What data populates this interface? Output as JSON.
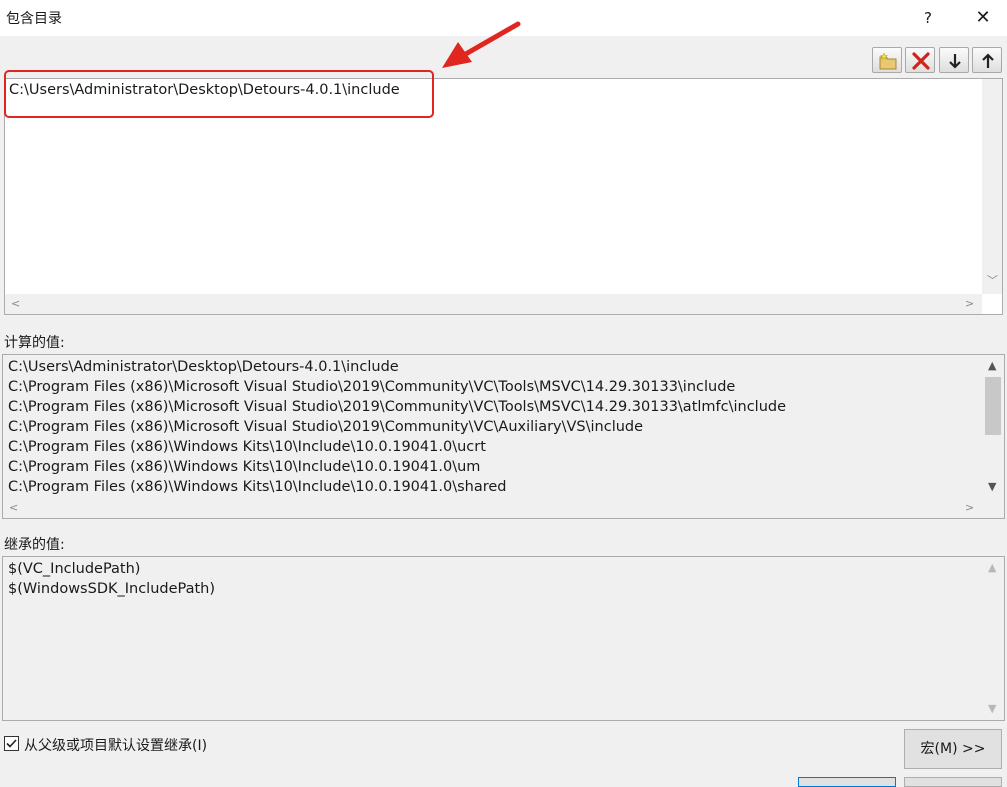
{
  "window": {
    "title": "包含目录",
    "help_label": "?",
    "close_label": "✕"
  },
  "toolbar": {
    "new_line_icon": "new-folder-icon",
    "delete_icon": "delete-x-icon",
    "move_down_icon": "arrow-down-icon",
    "move_up_icon": "arrow-up-icon"
  },
  "editor": {
    "lines": [
      "C:\\Users\\Administrator\\Desktop\\Detours-4.0.1\\include"
    ]
  },
  "computed": {
    "label": "计算的值:",
    "lines": [
      "C:\\Users\\Administrator\\Desktop\\Detours-4.0.1\\include",
      "C:\\Program Files (x86)\\Microsoft Visual Studio\\2019\\Community\\VC\\Tools\\MSVC\\14.29.30133\\include",
      "C:\\Program Files (x86)\\Microsoft Visual Studio\\2019\\Community\\VC\\Tools\\MSVC\\14.29.30133\\atlmfc\\include",
      "C:\\Program Files (x86)\\Microsoft Visual Studio\\2019\\Community\\VC\\Auxiliary\\VS\\include",
      "C:\\Program Files (x86)\\Windows Kits\\10\\Include\\10.0.19041.0\\ucrt",
      "C:\\Program Files (x86)\\Windows Kits\\10\\Include\\10.0.19041.0\\um",
      "C:\\Program Files (x86)\\Windows Kits\\10\\Include\\10.0.19041.0\\shared"
    ]
  },
  "inherited": {
    "label": "继承的值:",
    "lines": [
      "$(VC_IncludePath)",
      "$(WindowsSDK_IncludePath)"
    ]
  },
  "inherit_checkbox": {
    "label": "从父级或项目默认设置继承(I)",
    "checked": true
  },
  "macro_button": "宏(M) >>",
  "colors": {
    "annotation": "#e0261f",
    "dialog_bg": "#f0f0f0"
  }
}
